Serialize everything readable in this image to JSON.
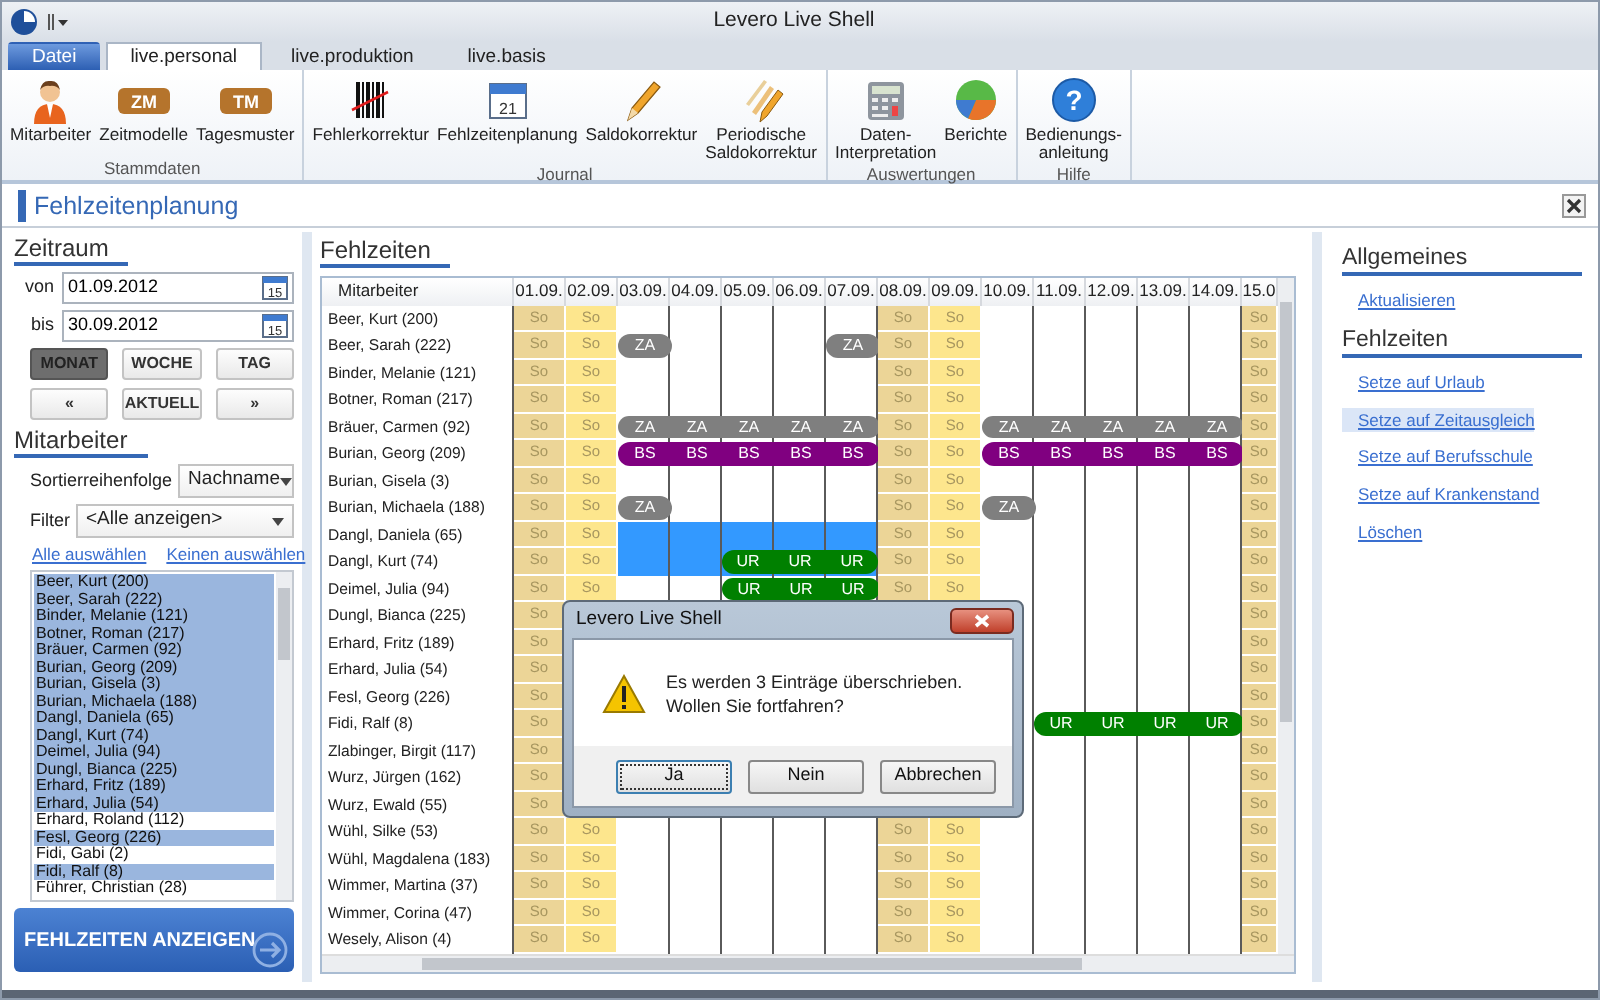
{
  "window": {
    "title": "Levero Live Shell"
  },
  "ribbon": {
    "tabs": [
      {
        "label": "Datei",
        "kind": "file",
        "selected": false
      },
      {
        "label": "live.personal",
        "kind": "tab",
        "selected": true
      },
      {
        "label": "live.produktion",
        "kind": "tab",
        "selected": false
      },
      {
        "label": "live.basis",
        "kind": "tab",
        "selected": false
      }
    ],
    "groups": [
      {
        "label": "Stammdaten",
        "buttons": [
          {
            "label": "Mitarbeiter",
            "kind": "person"
          },
          {
            "label": "Zeitmodelle",
            "kind": "badge",
            "badge": "ZM"
          },
          {
            "label": "Tagesmuster",
            "kind": "badge",
            "badge": "TM"
          }
        ]
      },
      {
        "label": "Journal",
        "buttons": [
          {
            "label": "Fehlerkorrektur",
            "kind": "barcode"
          },
          {
            "label": "Fehlzeitenplanung",
            "kind": "calendar",
            "badge": "21"
          },
          {
            "label": "Saldokorrektur",
            "kind": "pencil"
          },
          {
            "label": "Periodische\nSaldokorrektur",
            "kind": "pencils"
          }
        ]
      },
      {
        "label": "Auswertungen",
        "buttons": [
          {
            "label": "Daten-\nInterpretation",
            "kind": "calculator"
          },
          {
            "label": "Berichte",
            "kind": "pie"
          }
        ]
      },
      {
        "label": "Hilfe",
        "buttons": [
          {
            "label": "Bedienungs-\nanleitung",
            "kind": "help",
            "badge": "?"
          }
        ]
      }
    ]
  },
  "document": {
    "title": "Fehlzeitenplanung"
  },
  "period": {
    "title": "Zeitraum",
    "fields": [
      {
        "label": "von",
        "value": "01.09.2012",
        "calendar_day": "15"
      },
      {
        "label": "bis",
        "value": "30.09.2012",
        "calendar_day": "15"
      }
    ],
    "view_buttons": [
      {
        "label": "MONAT",
        "selected": true
      },
      {
        "label": "WOCHE",
        "selected": false
      },
      {
        "label": "TAG",
        "selected": false
      }
    ],
    "nav_buttons": [
      "«",
      "AKTUELL",
      "»"
    ]
  },
  "employees": {
    "title": "Mitarbeiter",
    "sort": {
      "label": "Sortierreihenfolge",
      "value": "Nachname"
    },
    "filter": {
      "label": "Filter",
      "value": "<Alle anzeigen>"
    },
    "links": [
      "Alle auswählen",
      "Keinen auswählen"
    ],
    "items": [
      {
        "name": "Beer, Kurt (200)",
        "selected": true
      },
      {
        "name": "Beer, Sarah (222)",
        "selected": true
      },
      {
        "name": "Binder, Melanie (121)",
        "selected": true
      },
      {
        "name": "Botner, Roman (217)",
        "selected": true
      },
      {
        "name": "Bräuer, Carmen (92)",
        "selected": true
      },
      {
        "name": "Burian, Georg (209)",
        "selected": true
      },
      {
        "name": "Burian, Gisela (3)",
        "selected": true
      },
      {
        "name": "Burian, Michaela (188)",
        "selected": true
      },
      {
        "name": "Dangl, Daniela (65)",
        "selected": true
      },
      {
        "name": "Dangl, Kurt (74)",
        "selected": true
      },
      {
        "name": "Deimel, Julia (94)",
        "selected": true
      },
      {
        "name": "Dungl, Bianca (225)",
        "selected": true
      },
      {
        "name": "Erhard, Fritz (189)",
        "selected": true
      },
      {
        "name": "Erhard, Julia (54)",
        "selected": true
      },
      {
        "name": "Erhard, Roland (112)",
        "selected": false
      },
      {
        "name": "Fesl, Georg (226)",
        "selected": true
      },
      {
        "name": "Fidi, Gabi (2)",
        "selected": false
      },
      {
        "name": "Fidi, Ralf (8)",
        "selected": true
      },
      {
        "name": "Führer, Christian (28)",
        "selected": false
      }
    ],
    "action": "FEHLZEITEN ANZEIGEN"
  },
  "absences": {
    "title": "Fehlzeiten",
    "header": "Mitarbeiter",
    "columns": [
      {
        "label": "01.09.",
        "kind": "saturday"
      },
      {
        "label": "02.09.",
        "kind": "sunday"
      },
      {
        "label": "03.09.",
        "kind": "weekday"
      },
      {
        "label": "04.09.",
        "kind": "weekday"
      },
      {
        "label": "05.09.",
        "kind": "weekday"
      },
      {
        "label": "06.09.",
        "kind": "weekday"
      },
      {
        "label": "07.09.",
        "kind": "weekday"
      },
      {
        "label": "08.09.",
        "kind": "saturday"
      },
      {
        "label": "09.09.",
        "kind": "sunday"
      },
      {
        "label": "10.09.",
        "kind": "weekday"
      },
      {
        "label": "11.09.",
        "kind": "weekday"
      },
      {
        "label": "12.09.",
        "kind": "weekday"
      },
      {
        "label": "13.09.",
        "kind": "weekday"
      },
      {
        "label": "14.09.",
        "kind": "weekday"
      },
      {
        "label": "15.0",
        "kind": "saturday"
      }
    ],
    "rows": [
      {
        "name": "Beer, Kurt (200)",
        "cells": [
          {
            "text": "So"
          },
          {
            "text": "So"
          },
          null,
          null,
          null,
          null,
          null,
          {
            "text": "So"
          },
          {
            "text": "So"
          },
          null,
          null,
          null,
          null,
          null,
          {
            "text": "So"
          }
        ]
      },
      {
        "name": "Beer, Sarah (222)",
        "cells": [
          {
            "text": "So"
          },
          {
            "text": "So"
          },
          {
            "text": "ZA",
            "color": "#7f7f7f"
          },
          null,
          null,
          null,
          {
            "text": "ZA",
            "color": "#7f7f7f"
          },
          {
            "text": "So"
          },
          {
            "text": "So"
          },
          null,
          null,
          null,
          null,
          null,
          {
            "text": "So"
          }
        ]
      },
      {
        "name": "Binder, Melanie (121)",
        "cells": [
          {
            "text": "So"
          },
          {
            "text": "So"
          },
          null,
          null,
          null,
          null,
          null,
          {
            "text": "So"
          },
          {
            "text": "So"
          },
          null,
          null,
          null,
          null,
          null,
          {
            "text": "So"
          }
        ]
      },
      {
        "name": "Botner, Roman (217)",
        "cells": [
          {
            "text": "So"
          },
          {
            "text": "So"
          },
          null,
          null,
          null,
          null,
          null,
          {
            "text": "So"
          },
          {
            "text": "So"
          },
          null,
          null,
          null,
          null,
          null,
          {
            "text": "So"
          }
        ]
      },
      {
        "name": "Bräuer, Carmen (92)",
        "cells": [
          {
            "text": "So"
          },
          {
            "text": "So"
          },
          {
            "text": "ZA",
            "color": "#7f7f7f"
          },
          {
            "text": "ZA",
            "color": "#7f7f7f"
          },
          {
            "text": "ZA",
            "color": "#7f7f7f"
          },
          {
            "text": "ZA",
            "color": "#7f7f7f"
          },
          {
            "text": "ZA",
            "color": "#7f7f7f"
          },
          {
            "text": "So"
          },
          {
            "text": "So"
          },
          {
            "text": "ZA",
            "color": "#7f7f7f"
          },
          {
            "text": "ZA",
            "color": "#7f7f7f"
          },
          {
            "text": "ZA",
            "color": "#7f7f7f"
          },
          {
            "text": "ZA",
            "color": "#7f7f7f"
          },
          {
            "text": "ZA",
            "color": "#7f7f7f"
          },
          {
            "text": "So"
          }
        ]
      },
      {
        "name": "Burian, Georg (209)",
        "cells": [
          {
            "text": "So"
          },
          {
            "text": "So"
          },
          {
            "text": "BS",
            "color": "#800080"
          },
          {
            "text": "BS",
            "color": "#800080"
          },
          {
            "text": "BS",
            "color": "#800080"
          },
          {
            "text": "BS",
            "color": "#800080"
          },
          {
            "text": "BS",
            "color": "#800080"
          },
          {
            "text": "So"
          },
          {
            "text": "So"
          },
          {
            "text": "BS",
            "color": "#800080"
          },
          {
            "text": "BS",
            "color": "#800080"
          },
          {
            "text": "BS",
            "color": "#800080"
          },
          {
            "text": "BS",
            "color": "#800080"
          },
          {
            "text": "BS",
            "color": "#800080"
          },
          {
            "text": "So"
          }
        ]
      },
      {
        "name": "Burian, Gisela (3)",
        "cells": [
          {
            "text": "So"
          },
          {
            "text": "So"
          },
          null,
          null,
          null,
          null,
          null,
          {
            "text": "So"
          },
          {
            "text": "So"
          },
          null,
          null,
          null,
          null,
          null,
          {
            "text": "So"
          }
        ]
      },
      {
        "name": "Burian, Michaela (188)",
        "cells": [
          {
            "text": "So"
          },
          {
            "text": "So"
          },
          {
            "text": "ZA",
            "color": "#7f7f7f"
          },
          null,
          null,
          null,
          null,
          {
            "text": "So"
          },
          {
            "text": "So"
          },
          {
            "text": "ZA",
            "color": "#7f7f7f"
          },
          null,
          null,
          null,
          null,
          {
            "text": "So"
          }
        ]
      },
      {
        "name": "Dangl, Daniela (65)",
        "cells": [
          {
            "text": "So"
          },
          {
            "text": "So"
          },
          {
            "selected": true
          },
          {
            "selected": true
          },
          {
            "selected": true
          },
          {
            "selected": true
          },
          {
            "selected": true
          },
          {
            "text": "So"
          },
          {
            "text": "So"
          },
          null,
          null,
          null,
          null,
          null,
          {
            "text": "So"
          }
        ]
      },
      {
        "name": "Dangl, Kurt (74)",
        "cells": [
          {
            "text": "So"
          },
          {
            "text": "So"
          },
          {
            "selected": true
          },
          {
            "selected": true
          },
          {
            "text": "UR",
            "color": "#008000",
            "selected": true
          },
          {
            "text": "UR",
            "color": "#008000",
            "selected": true
          },
          {
            "text": "UR",
            "color": "#008000",
            "selected": true
          },
          {
            "text": "So"
          },
          {
            "text": "So"
          },
          null,
          null,
          null,
          null,
          null,
          {
            "text": "So"
          }
        ]
      },
      {
        "name": "Deimel, Julia (94)",
        "cells": [
          {
            "text": "So"
          },
          {
            "text": "So"
          },
          null,
          null,
          {
            "text": "UR",
            "color": "#008000"
          },
          {
            "text": "UR",
            "color": "#008000"
          },
          {
            "text": "UR",
            "color": "#008000"
          },
          {
            "text": "So"
          },
          {
            "text": "So"
          },
          null,
          null,
          null,
          null,
          null,
          {
            "text": "So"
          }
        ]
      },
      {
        "name": "Dungl, Bianca (225)",
        "cells": [
          {
            "text": "So"
          },
          null,
          null,
          null,
          null,
          null,
          null,
          null,
          null,
          null,
          null,
          null,
          null,
          null,
          {
            "text": "So"
          }
        ]
      },
      {
        "name": "Erhard, Fritz (189)",
        "cells": [
          {
            "text": "So"
          },
          null,
          null,
          null,
          null,
          null,
          null,
          null,
          null,
          null,
          null,
          null,
          null,
          null,
          {
            "text": "So"
          }
        ]
      },
      {
        "name": "Erhard, Julia (54)",
        "cells": [
          {
            "text": "So"
          },
          null,
          null,
          null,
          null,
          null,
          null,
          null,
          null,
          null,
          null,
          null,
          null,
          null,
          {
            "text": "So"
          }
        ]
      },
      {
        "name": "Fesl, Georg (226)",
        "cells": [
          {
            "text": "So"
          },
          null,
          null,
          null,
          null,
          null,
          null,
          null,
          null,
          null,
          null,
          null,
          null,
          null,
          {
            "text": "So"
          }
        ]
      },
      {
        "name": "Fidi, Ralf (8)",
        "cells": [
          {
            "text": "So"
          },
          null,
          null,
          null,
          null,
          null,
          null,
          null,
          null,
          null,
          {
            "text": "UR",
            "color": "#008000"
          },
          {
            "text": "UR",
            "color": "#008000"
          },
          {
            "text": "UR",
            "color": "#008000"
          },
          {
            "text": "UR",
            "color": "#008000"
          },
          {
            "text": "So"
          }
        ]
      },
      {
        "name": "Zlabinger, Birgit (117)",
        "cells": [
          {
            "text": "So"
          },
          null,
          null,
          null,
          null,
          null,
          null,
          null,
          null,
          null,
          null,
          null,
          null,
          null,
          {
            "text": "So"
          }
        ]
      },
      {
        "name": "Wurz, Jürgen (162)",
        "cells": [
          {
            "text": "So"
          },
          null,
          null,
          null,
          null,
          null,
          null,
          null,
          null,
          null,
          null,
          null,
          null,
          null,
          {
            "text": "So"
          }
        ]
      },
      {
        "name": "Wurz, Ewald (55)",
        "cells": [
          {
            "text": "So"
          },
          null,
          null,
          null,
          null,
          null,
          null,
          null,
          null,
          null,
          null,
          null,
          null,
          null,
          {
            "text": "So"
          }
        ]
      },
      {
        "name": "Wühl, Silke (53)",
        "cells": [
          {
            "text": "So"
          },
          {
            "text": "So"
          },
          null,
          null,
          null,
          null,
          null,
          {
            "text": "So"
          },
          {
            "text": "So"
          },
          null,
          null,
          null,
          null,
          null,
          {
            "text": "So"
          }
        ]
      },
      {
        "name": "Wühl, Magdalena (183)",
        "cells": [
          {
            "text": "So"
          },
          {
            "text": "So"
          },
          null,
          null,
          null,
          null,
          null,
          {
            "text": "So"
          },
          {
            "text": "So"
          },
          null,
          null,
          null,
          null,
          null,
          {
            "text": "So"
          }
        ]
      },
      {
        "name": "Wimmer, Martina (37)",
        "cells": [
          {
            "text": "So"
          },
          {
            "text": "So"
          },
          null,
          null,
          null,
          null,
          null,
          {
            "text": "So"
          },
          {
            "text": "So"
          },
          null,
          null,
          null,
          null,
          null,
          {
            "text": "So"
          }
        ]
      },
      {
        "name": "Wimmer, Corina (47)",
        "cells": [
          {
            "text": "So"
          },
          {
            "text": "So"
          },
          null,
          null,
          null,
          null,
          null,
          {
            "text": "So"
          },
          {
            "text": "So"
          },
          null,
          null,
          null,
          null,
          null,
          {
            "text": "So"
          }
        ]
      },
      {
        "name": "Wesely, Alison (4)",
        "cells": [
          {
            "text": "So"
          },
          {
            "text": "So"
          },
          null,
          null,
          null,
          null,
          null,
          {
            "text": "So"
          },
          {
            "text": "So"
          },
          null,
          null,
          null,
          null,
          null,
          {
            "text": "So"
          }
        ]
      }
    ]
  },
  "actions": {
    "sections": [
      {
        "title": "Allgemeines",
        "links": [
          {
            "label": "Aktualisieren",
            "highlighted": false
          }
        ]
      },
      {
        "title": "Fehlzeiten",
        "links": [
          {
            "label": "Setze auf Urlaub",
            "highlighted": false
          },
          {
            "label": "Setze auf Zeitausgleich",
            "highlighted": true
          },
          {
            "label": "Setze auf Berufsschule",
            "highlighted": false
          },
          {
            "label": "Setze auf Krankenstand",
            "highlighted": false
          },
          {
            "label": "Löschen",
            "highlighted": false
          }
        ]
      }
    ]
  },
  "dialog": {
    "title": "Levero Live Shell",
    "message": "Es werden 3 Einträge überschrieben.\nWollen Sie fortfahren?",
    "buttons": [
      {
        "label": "Ja",
        "focused": true
      },
      {
        "label": "Nein",
        "focused": false
      },
      {
        "label": "Abbrechen",
        "focused": false
      }
    ]
  }
}
